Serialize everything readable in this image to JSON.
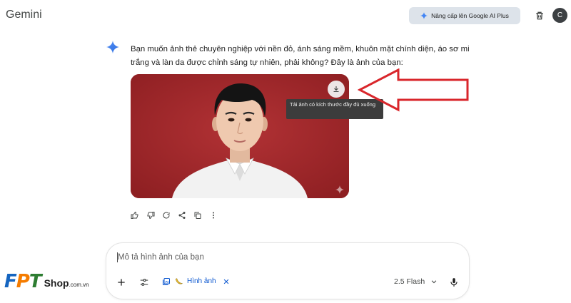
{
  "header": {
    "app_title": "Gemini",
    "upgrade_label": "Nâng cấp lên Google AI Plus",
    "avatar_letter": "C"
  },
  "response": {
    "text": "Bạn muốn ảnh thẻ chuyên nghiệp với nền đỏ, ánh sáng mềm, khuôn mặt chính diện, áo sơ mi trắng và làn da được chỉnh sáng tự nhiên, phải không? Đây là ảnh của bạn:",
    "tooltip": "Tải ảnh có kích thước đầy đủ xuống"
  },
  "input": {
    "placeholder": "Mô tả hình ảnh của bạn",
    "chip_label": "Hình ảnh",
    "model_label": "2.5 Flash"
  },
  "brand": {
    "letters": [
      "F",
      "P",
      "T"
    ],
    "shop": "Shop",
    "domain": ".com.vn"
  },
  "colors": {
    "accent_blue": "#0b57d0",
    "annotation_red": "#d9262b",
    "photo_background": "#a6292b",
    "fpt_blue": "#1565c0",
    "fpt_orange": "#f57c00",
    "fpt_green": "#2e7d32"
  },
  "icons": [
    "sparkle-icon",
    "trash-icon",
    "download-icon",
    "thumbs-up-icon",
    "thumbs-down-icon",
    "refresh-icon",
    "share-icon",
    "copy-icon",
    "more-icon",
    "plus-icon",
    "tools-icon",
    "image-icon",
    "banana-icon",
    "close-icon",
    "chevron-down-icon",
    "mic-icon"
  ]
}
